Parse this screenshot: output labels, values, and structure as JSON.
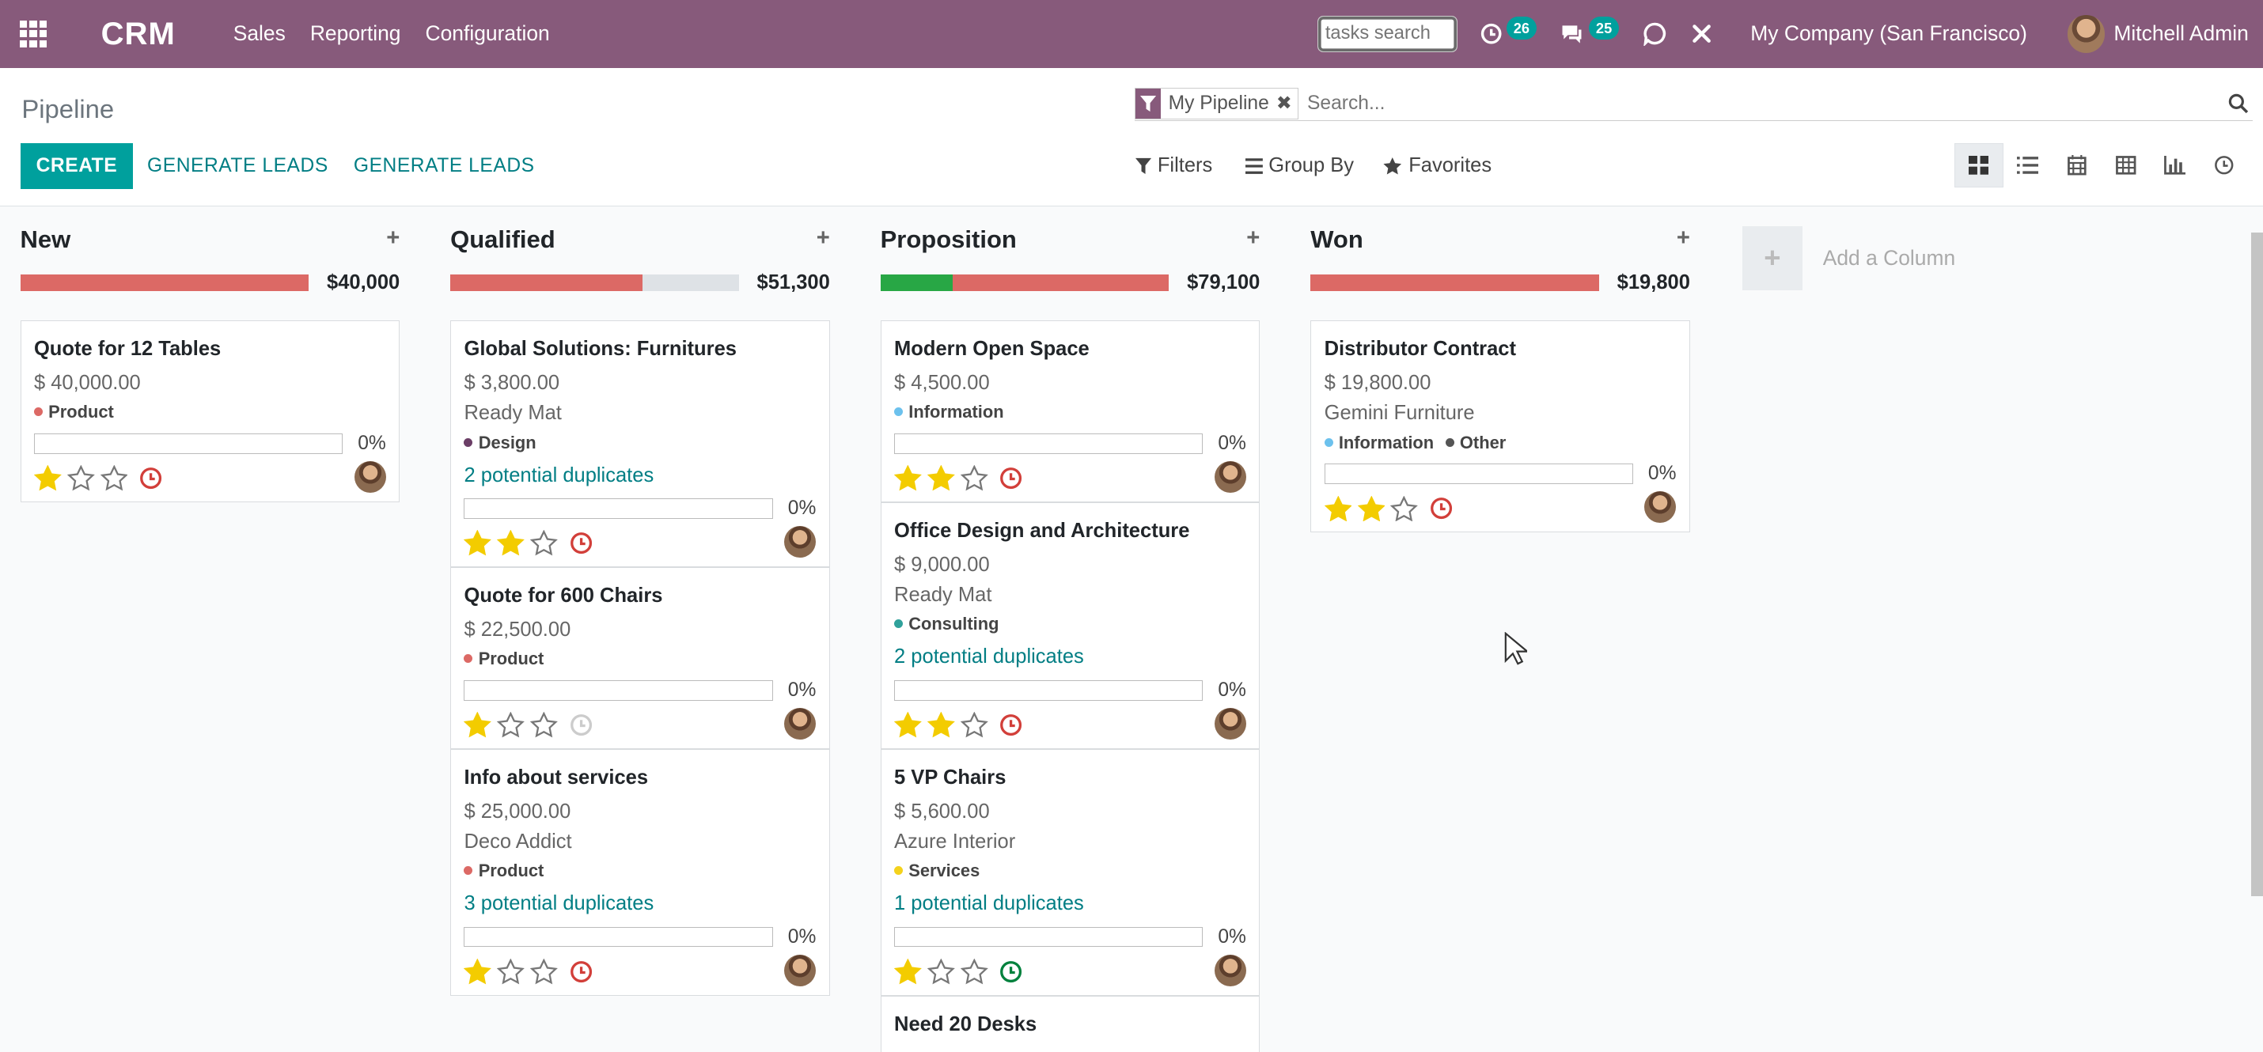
{
  "navbar": {
    "brand": "CRM",
    "menu": [
      "Sales",
      "Reporting",
      "Configuration"
    ],
    "tasks_placeholder": "tasks search",
    "activities_count": "26",
    "messages_count": "25",
    "company": "My Company (San Francisco)",
    "user": "Mitchell Admin"
  },
  "control_panel": {
    "breadcrumb": "Pipeline",
    "create_label": "CREATE",
    "generate_leads_1": "GENERATE LEADS",
    "generate_leads_2": "GENERATE LEADS",
    "facet_label": "My Pipeline",
    "search_placeholder": "Search...",
    "filters_label": "Filters",
    "groupby_label": "Group By",
    "favorites_label": "Favorites",
    "active_view": "kanban"
  },
  "colors": {
    "brand": "#875a7b",
    "accent": "#00a09d",
    "link": "#017e84",
    "progress_red": "#dc6965",
    "progress_green": "#28a745",
    "progress_empty": "#dee2e6",
    "star_gold": "#f3cc00",
    "clock_red": "#d23f3a",
    "clock_green": "#00813d",
    "clock_grey": "#cccccc"
  },
  "columns": [
    {
      "title": "New",
      "total": "$40,000",
      "progress": {
        "green": 0,
        "red": 1.0
      },
      "cards": [
        {
          "title": "Quote for 12 Tables",
          "amount": "$ 40,000.00",
          "partner": "",
          "tags": [
            {
              "label": "Product",
              "color": "#dc6965"
            }
          ],
          "duplicates": "",
          "percent": "0%",
          "stars": 1,
          "activity": "red"
        }
      ]
    },
    {
      "title": "Qualified",
      "total": "$51,300",
      "progress": {
        "green": 0,
        "red": 0.665
      },
      "cards": [
        {
          "title": "Global Solutions: Furnitures",
          "amount": "$ 3,800.00",
          "partner": "Ready Mat",
          "tags": [
            {
              "label": "Design",
              "color": "#6b3e66"
            }
          ],
          "duplicates": "2 potential duplicates",
          "percent": "0%",
          "stars": 2,
          "activity": "red"
        },
        {
          "title": "Quote for 600 Chairs",
          "amount": "$ 22,500.00",
          "partner": "",
          "tags": [
            {
              "label": "Product",
              "color": "#dc6965"
            }
          ],
          "duplicates": "",
          "percent": "0%",
          "stars": 1,
          "activity": "grey"
        },
        {
          "title": "Info about services",
          "amount": "$ 25,000.00",
          "partner": "Deco Addict",
          "tags": [
            {
              "label": "Product",
              "color": "#dc6965"
            }
          ],
          "duplicates": "3 potential duplicates",
          "percent": "0%",
          "stars": 1,
          "activity": "red"
        }
      ]
    },
    {
      "title": "Proposition",
      "total": "$79,100",
      "progress": {
        "green": 0.25,
        "red": 0.75
      },
      "cards": [
        {
          "title": "Modern Open Space",
          "amount": "$ 4,500.00",
          "partner": "",
          "tags": [
            {
              "label": "Information",
              "color": "#6cc1ed"
            }
          ],
          "duplicates": "",
          "percent": "0%",
          "stars": 2,
          "activity": "red"
        },
        {
          "title": "Office Design and Architecture",
          "amount": "$ 9,000.00",
          "partner": "Ready Mat",
          "tags": [
            {
              "label": "Consulting",
              "color": "#30a19b"
            }
          ],
          "duplicates": "2 potential duplicates",
          "percent": "0%",
          "stars": 2,
          "activity": "red"
        },
        {
          "title": "5 VP Chairs",
          "amount": "$ 5,600.00",
          "partner": "Azure Interior",
          "tags": [
            {
              "label": "Services",
              "color": "#f4d21c"
            }
          ],
          "duplicates": "1 potential duplicates",
          "percent": "0%",
          "stars": 1,
          "activity": "green"
        },
        {
          "title": "Need 20 Desks",
          "amount": "",
          "partner": "",
          "tags": [],
          "duplicates": "",
          "percent": "",
          "stars": 0,
          "activity": ""
        }
      ]
    },
    {
      "title": "Won",
      "total": "$19,800",
      "progress": {
        "green": 0,
        "red": 1.0
      },
      "cards": [
        {
          "title": "Distributor Contract",
          "amount": "$ 19,800.00",
          "partner": "Gemini Furniture",
          "tags": [
            {
              "label": "Information",
              "color": "#6cc1ed"
            },
            {
              "label": "Other",
              "color": "#555555"
            }
          ],
          "duplicates": "",
          "percent": "0%",
          "stars": 2,
          "activity": "red"
        }
      ]
    }
  ],
  "add_column_label": "Add a Column"
}
